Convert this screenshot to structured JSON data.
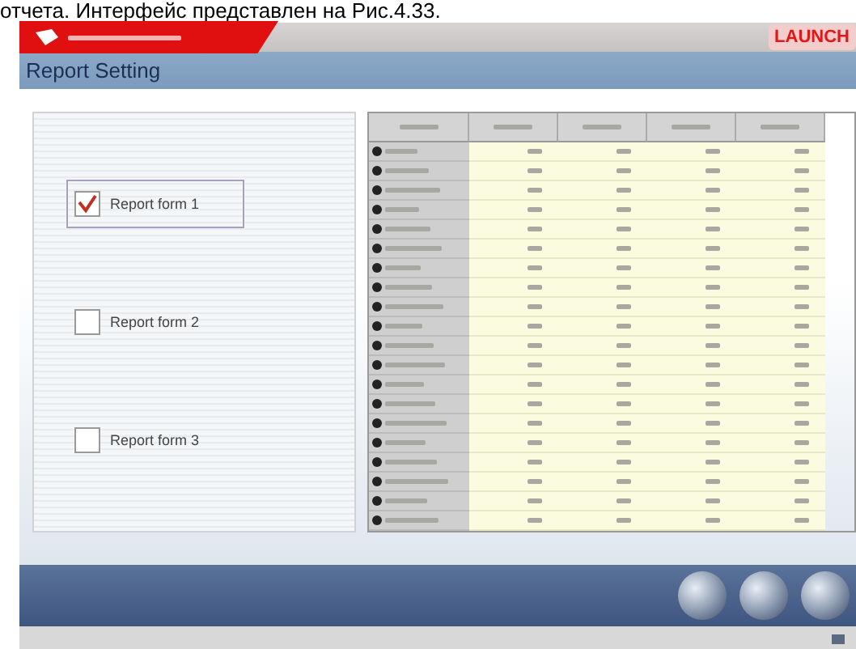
{
  "caption": "отчета. Интерфейс представлен на Рис.4.33.",
  "header": {
    "brand": "LAUNCH"
  },
  "window": {
    "title": "Report Setting"
  },
  "forms": [
    {
      "label": "Report form 1",
      "checked": true,
      "selected": true
    },
    {
      "label": "Report form 2",
      "checked": false,
      "selected": false
    },
    {
      "label": "Report form 3",
      "checked": false,
      "selected": false
    }
  ],
  "table": {
    "kind": "illegible"
  }
}
